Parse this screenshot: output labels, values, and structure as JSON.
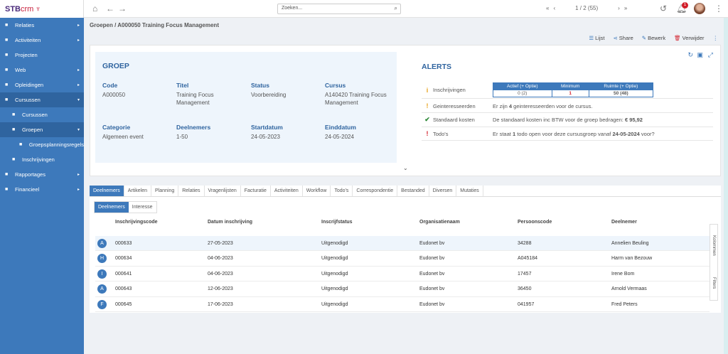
{
  "logo": {
    "text": "STB",
    "suffix": "crm"
  },
  "sidebar": {
    "items": [
      {
        "label": "Relaties",
        "icon": "sitemap-icon",
        "caret": "▸"
      },
      {
        "label": "Activiteiten",
        "icon": "clipboard-icon",
        "caret": "▸"
      },
      {
        "label": "Projecten",
        "icon": "briefcase-icon",
        "caret": ""
      },
      {
        "label": "Web",
        "icon": "globe-icon",
        "caret": "▸"
      },
      {
        "label": "Opleidingen",
        "icon": "calendar-icon",
        "caret": "▸"
      },
      {
        "label": "Cursussen",
        "icon": "graduation-cap-icon",
        "caret": "▾"
      },
      {
        "label": "Cursussen",
        "icon": "graduation-cap-icon",
        "caret": ""
      },
      {
        "label": "Groepen",
        "icon": "users-icon",
        "caret": "▾"
      },
      {
        "label": "Groepsplanningsregels",
        "icon": "users-icon",
        "caret": ""
      },
      {
        "label": "Inschrijvingen",
        "icon": "envelope-icon",
        "caret": ""
      },
      {
        "label": "Rapportages",
        "icon": "report-icon",
        "caret": "▸"
      },
      {
        "label": "Financieel",
        "icon": "money-icon",
        "caret": "▸"
      }
    ]
  },
  "topbar": {
    "search_placeholder": "Zoeken...",
    "pager": "1 / 2 (55)",
    "notifications": "1"
  },
  "breadcrumb": "Groepen / A000050 Training Focus Management",
  "actions": {
    "list": "Lijst",
    "share": "Share",
    "edit": "Bewerk",
    "delete": "Verwijder"
  },
  "groep": {
    "title": "GROEP",
    "fields": [
      {
        "label": "Code",
        "value": "A000050"
      },
      {
        "label": "Titel",
        "value": "Training Focus Management"
      },
      {
        "label": "Status",
        "value": "Voorbereiding"
      },
      {
        "label": "Cursus",
        "value": "A140420 Training Focus Management"
      },
      {
        "label": "Categorie",
        "value": "Algemeen event"
      },
      {
        "label": "Deelnemers",
        "value": "1-50"
      },
      {
        "label": "Startdatum",
        "value": "24-05-2023"
      },
      {
        "label": "Einddatum",
        "value": "24-05-2024"
      }
    ]
  },
  "alerts": {
    "title": "ALERTS",
    "inschrijvingen": {
      "label": "Inschrijvingen",
      "headers": [
        "Actief (+ Optie)",
        "Minimum",
        "Ruimte (+ Optie)"
      ],
      "values": [
        "0 (2)",
        "1",
        "50 (48)"
      ]
    },
    "rows": [
      {
        "icon": "!",
        "label": "Geinteresseerden",
        "pre": "Er zijn ",
        "b1": "4",
        "mid": " geinteresseerden voor de cursus.",
        "b2": "",
        "post": ""
      },
      {
        "icon": "✔",
        "label": "Standaard kosten",
        "pre": "De standaard kosten inc BTW voor de groep bedragen: ",
        "b1": "€ 95,92",
        "mid": "",
        "b2": "",
        "post": ""
      },
      {
        "icon": "!",
        "label": "Todo's",
        "pre": "Er staat ",
        "b1": "1",
        "mid": " todo open voor deze cursusgroep vanaf ",
        "b2": "24-05-2024",
        "post": " voor?"
      }
    ]
  },
  "tabs": [
    "Deelnemers",
    "Artikelen",
    "Planning",
    "Relaties",
    "Vragenlijsten",
    "Facturatie",
    "Activiteiten",
    "Workflow",
    "Todo's",
    "Correspondentie",
    "Bestanded",
    "Diversen",
    "Mutaties"
  ],
  "subtabs": [
    "Deelnemers",
    "Interesse"
  ],
  "table": {
    "headers": [
      "Inschrijvingscode",
      "Datum inschrijving",
      "Inscrijfstatus",
      "Organisatienaam",
      "Persoonscode",
      "Deelnemer"
    ],
    "rows": [
      {
        "initial": "A",
        "cells": [
          "000633",
          "27-05-2023",
          "Uitgenodigd",
          "Eudonet bv",
          "34288",
          "Annelien Beuling"
        ]
      },
      {
        "initial": "H",
        "cells": [
          "000634",
          "04-06-2023",
          "Uitgenodigd",
          "Eudonet bv",
          "A045184",
          "Harm van Bezouw"
        ]
      },
      {
        "initial": "I",
        "cells": [
          "000641",
          "04-06-2023",
          "Uitgenodigd",
          "Eudonet bv",
          "17457",
          "Irene Bom"
        ]
      },
      {
        "initial": "A",
        "cells": [
          "000643",
          "12-06-2023",
          "Uitgenodigd",
          "Eudonet bv",
          "36450",
          "Arnold Vermaas"
        ]
      },
      {
        "initial": "F",
        "cells": [
          "000645",
          "17-06-2023",
          "Uitgenodigd",
          "Eudonet bv",
          "041957",
          "Fred Peters"
        ]
      }
    ]
  },
  "side": {
    "columns": "Kolommen",
    "filters": "Filters"
  }
}
